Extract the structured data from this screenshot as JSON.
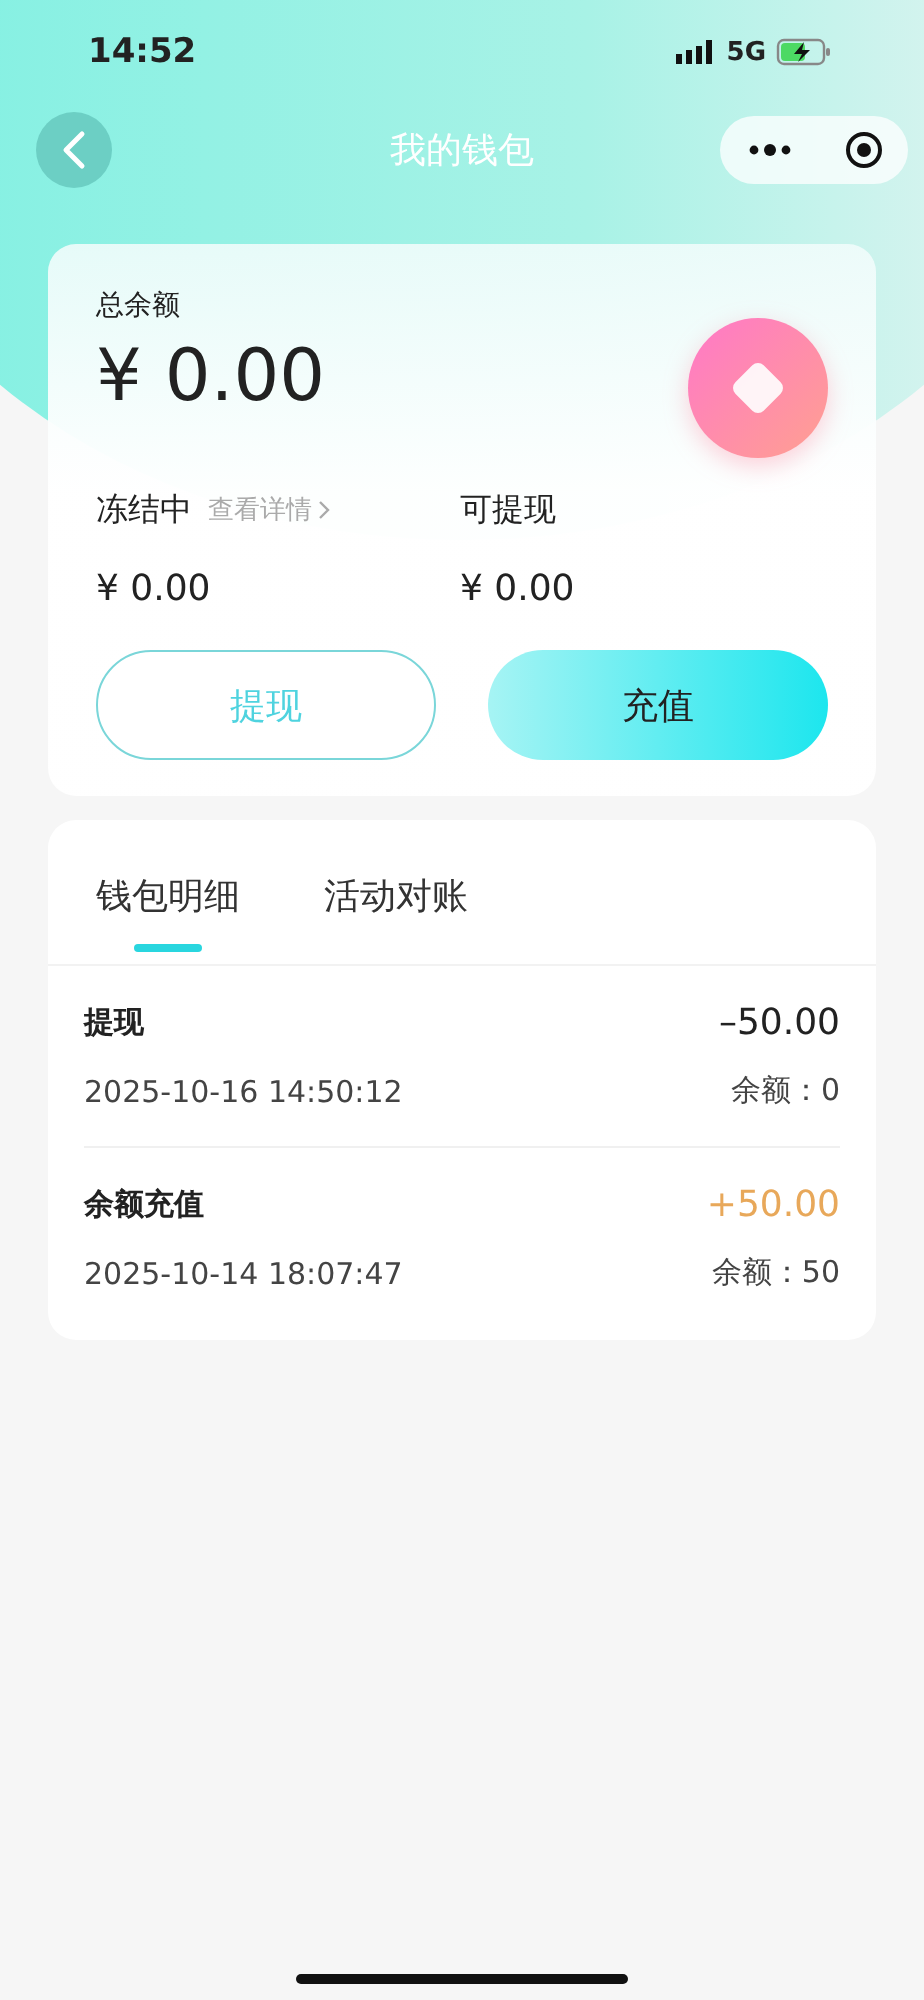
{
  "status_bar": {
    "time": "14:52",
    "network": "5G"
  },
  "nav": {
    "title": "我的钱包"
  },
  "balance": {
    "label": "总余额",
    "amount": "¥ 0.00",
    "frozen": {
      "label": "冻结中",
      "link": "查看详情",
      "amount": "¥ 0.00"
    },
    "withdrawable": {
      "label": "可提现",
      "amount": "¥ 0.00"
    }
  },
  "buttons": [
    {
      "label": "提现",
      "kind": "outline"
    },
    {
      "label": "充值",
      "kind": "filled"
    }
  ],
  "tabs": [
    {
      "label": "钱包明细",
      "selected": true
    },
    {
      "label": "活动对账",
      "selected": false
    }
  ],
  "records": [
    {
      "title": "提现",
      "time": "2025-10-16 14:50:12",
      "amount": "–50.00",
      "kind": "expense",
      "balance": "余额：0"
    },
    {
      "title": "余额充值",
      "time": "2025-10-14 18:07:47",
      "amount": "+50.00",
      "kind": "income",
      "balance": "余额：50"
    }
  ]
}
